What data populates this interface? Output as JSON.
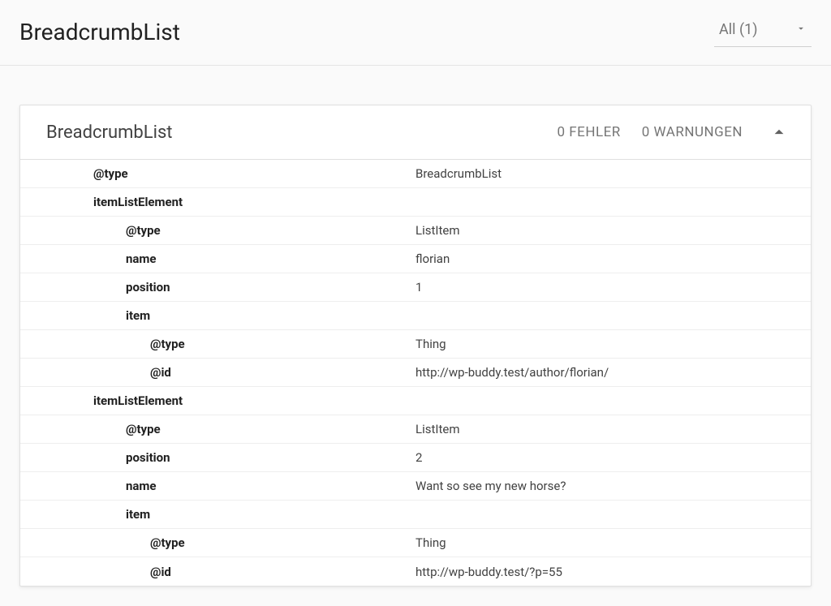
{
  "header": {
    "title": "BreadcrumbList",
    "filter_label": "All (1)"
  },
  "card": {
    "title": "BreadcrumbList",
    "errors_label": "0 FEHLER",
    "warnings_label": "0 WARNUNGEN"
  },
  "rows": {
    "r0_key": "@type",
    "r0_val": "BreadcrumbList",
    "r1_key": "itemListElement",
    "r1_val": "",
    "r2_key": "@type",
    "r2_val": "ListItem",
    "r3_key": "name",
    "r3_val": "florian",
    "r4_key": "position",
    "r4_val": "1",
    "r5_key": "item",
    "r5_val": "",
    "r6_key": "@type",
    "r6_val": "Thing",
    "r7_key": "@id",
    "r7_val": "http://wp-buddy.test/author/florian/",
    "r8_key": "itemListElement",
    "r8_val": "",
    "r9_key": "@type",
    "r9_val": "ListItem",
    "r10_key": "position",
    "r10_val": "2",
    "r11_key": "name",
    "r11_val": "Want so see my new horse?",
    "r12_key": "item",
    "r12_val": "",
    "r13_key": "@type",
    "r13_val": "Thing",
    "r14_key": "@id",
    "r14_val": "http://wp-buddy.test/?p=55"
  }
}
